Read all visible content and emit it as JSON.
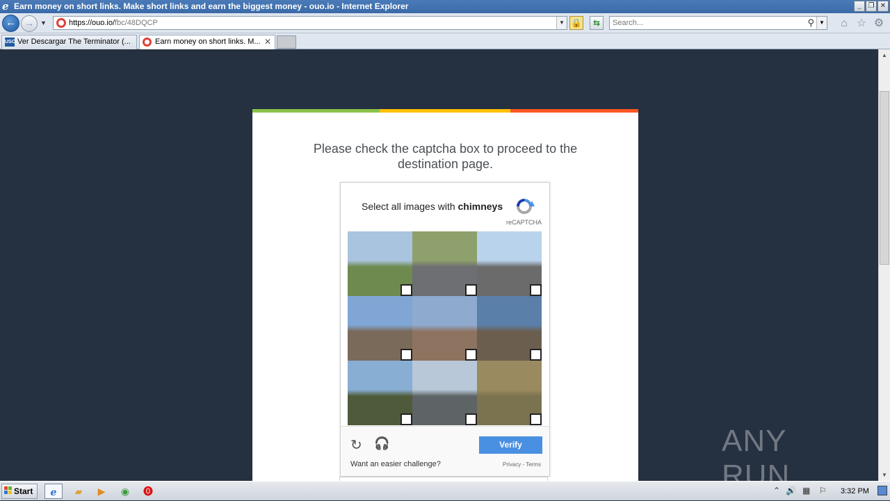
{
  "window": {
    "title": "Earn money on short links. Make short links and earn the biggest money - ouo.io - Internet Explorer"
  },
  "navbar": {
    "url_host": "https://ouo.io/",
    "url_path": "fbc/48DQCP",
    "search_placeholder": "Search..."
  },
  "tabs": [
    {
      "label": "Ver Descargar The Terminator (...",
      "icon": "usc-icon",
      "active": false
    },
    {
      "label": "Earn money on short links. M...",
      "icon": "ouo-icon",
      "active": true
    }
  ],
  "page": {
    "heading": "Please check the captcha box to proceed to the destination page.",
    "top_bar_colors": [
      "#8bc34a",
      "#ffc107",
      "#ff5722"
    ]
  },
  "captcha": {
    "prompt_prefix": "Select all images with ",
    "prompt_target": "chimneys",
    "brand": "reCAPTCHA",
    "verify_label": "Verify",
    "easier_label": "Want an easier challenge?",
    "privacy_terms": "Privacy - Terms",
    "tiles": [
      {
        "name": "highway-sign-tile",
        "sky": "#a9c4df",
        "ground": "#6e8a4e"
      },
      {
        "name": "road-motorbike-tile",
        "sky": "#8ea06b",
        "ground": "#6d6f72"
      },
      {
        "name": "street-palms-tile",
        "sky": "#b9d3ec",
        "ground": "#6b6b6b"
      },
      {
        "name": "clouds-house-tile",
        "sky": "#7fa6d4",
        "ground": "#7a6a5a"
      },
      {
        "name": "brick-house-tile",
        "sky": "#8faacf",
        "ground": "#8d7360"
      },
      {
        "name": "roof-tile",
        "sky": "#5a7fa8",
        "ground": "#6b5e4e"
      },
      {
        "name": "palm-trees-tile",
        "sky": "#89aed4",
        "ground": "#4f5a3a"
      },
      {
        "name": "freeway-traffic-tile",
        "sky": "#b8c8d8",
        "ground": "#5e6366"
      },
      {
        "name": "yard-car-tile",
        "sky": "#9a8a60",
        "ground": "#7b7350"
      }
    ]
  },
  "watermark": "ANY RUN",
  "taskbar": {
    "start_label": "Start",
    "clock": "3:32 PM"
  }
}
